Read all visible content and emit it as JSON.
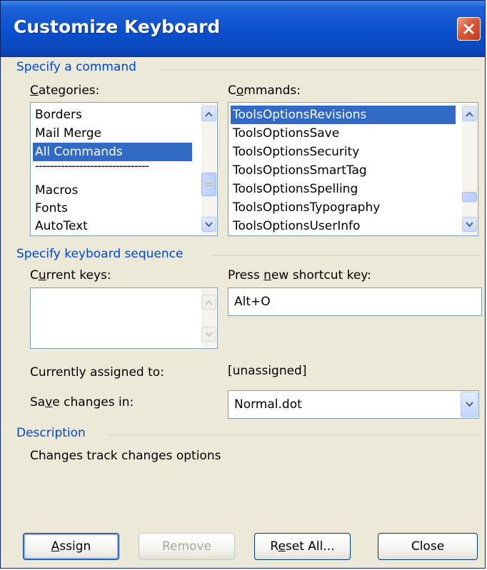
{
  "window": {
    "title": "Customize Keyboard"
  },
  "section_command": {
    "heading": "Specify a command",
    "categories_label": "Categories:",
    "categories": [
      "Borders",
      "Mail Merge",
      "All Commands",
      "-------------------------------",
      "Macros",
      "Fonts",
      "AutoText"
    ],
    "categories_selected": "All Commands",
    "commands_label": "Commands:",
    "commands": [
      "ToolsOptionsRevisions",
      "ToolsOptionsSave",
      "ToolsOptionsSecurity",
      "ToolsOptionsSmartTag",
      "ToolsOptionsSpelling",
      "ToolsOptionsTypography",
      "ToolsOptionsUserInfo"
    ],
    "commands_selected": "ToolsOptionsRevisions"
  },
  "section_keys": {
    "heading": "Specify keyboard sequence",
    "current_keys_label": "Current keys:",
    "press_new_label": "Press new shortcut key:",
    "new_shortcut_value": "Alt+O",
    "currently_assigned_label": "Currently assigned to:",
    "currently_assigned_value": "[unassigned]",
    "save_changes_label": "Save changes in:",
    "save_changes_value": "Normal.dot"
  },
  "section_description": {
    "heading": "Description",
    "text": "Changes track changes options"
  },
  "buttons": {
    "assign": "Assign",
    "remove": "Remove",
    "reset_all": "Reset All...",
    "close": "Close"
  },
  "colors": {
    "accent": "#316ac5",
    "section_heading": "#0046d5",
    "title_bar": "#0a4fce",
    "close_button": "#e05a3a"
  }
}
